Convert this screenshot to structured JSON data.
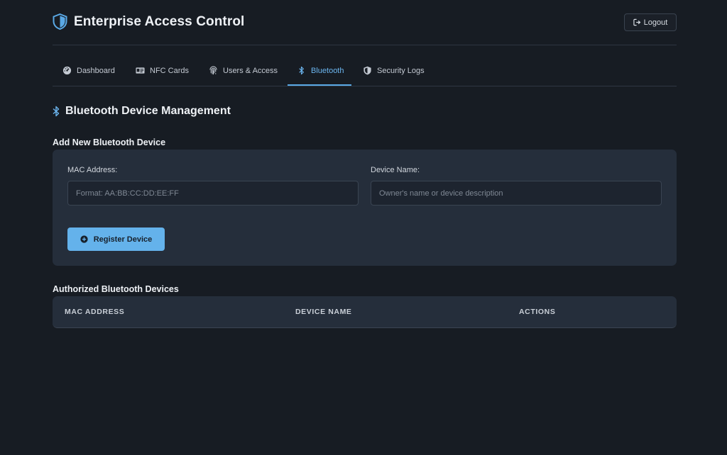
{
  "header": {
    "title": "Enterprise Access Control",
    "logout_label": "Logout"
  },
  "tabs": [
    {
      "label": "Dashboard",
      "icon": "dashboard-icon",
      "active": false
    },
    {
      "label": "NFC Cards",
      "icon": "id-card-icon",
      "active": false
    },
    {
      "label": "Users & Access",
      "icon": "fingerprint-icon",
      "active": false
    },
    {
      "label": "Bluetooth",
      "icon": "bluetooth-icon",
      "active": true
    },
    {
      "label": "Security Logs",
      "icon": "shield-icon",
      "active": false
    }
  ],
  "section": {
    "title": "Bluetooth Device Management"
  },
  "form": {
    "title": "Add New Bluetooth Device",
    "mac_label": "MAC Address:",
    "mac_placeholder": "Format: AA:BB:CC:DD:EE:FF",
    "mac_value": "",
    "name_label": "Device Name:",
    "name_placeholder": "Owner's name or device description",
    "name_value": "",
    "submit_label": "Register Device"
  },
  "devices": {
    "title": "Authorized Bluetooth Devices",
    "columns": [
      "MAC ADDRESS",
      "DEVICE NAME",
      "ACTIONS"
    ],
    "rows": []
  },
  "colors": {
    "background": "#171c23",
    "card": "#252e3b",
    "accent": "#64b2eb",
    "active_tab": "#6cb6f0"
  }
}
